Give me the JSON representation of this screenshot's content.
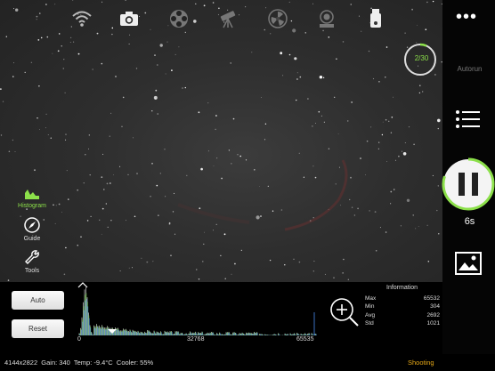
{
  "toolbar": {
    "icons": [
      "wifi-icon",
      "camera-icon",
      "filter-wheel-icon",
      "telescope-icon",
      "fan-icon",
      "mount-icon",
      "usb-drive-icon"
    ]
  },
  "sequence": {
    "progress_text": "2/30",
    "progress_fraction": 0.067,
    "autorun_label": "Autorun",
    "exposure_time": "6s",
    "exposure_progress_fraction": 0.8
  },
  "side_tools": {
    "histogram_label": "Histogram",
    "guide_label": "Guide",
    "tools_label": "Tools"
  },
  "buttons": {
    "auto_label": "Auto",
    "reset_label": "Reset"
  },
  "histogram": {
    "tick_min": "0",
    "tick_mid": "32768",
    "tick_max": "65535"
  },
  "information": {
    "title": "Information",
    "rows": [
      {
        "label": "Max",
        "value": "65532"
      },
      {
        "label": "Min",
        "value": "304"
      },
      {
        "label": "Avg",
        "value": "2692"
      },
      {
        "label": "Std",
        "value": "1021"
      }
    ]
  },
  "status": {
    "resolution": "4144x2822",
    "gain": "Gain: 340",
    "temp": "Temp: -9.4°C",
    "cooler": "Cooler: 55%",
    "state": "Shooting"
  },
  "colors": {
    "accent_green": "#8ce04a",
    "status_orange": "#e6a817"
  }
}
